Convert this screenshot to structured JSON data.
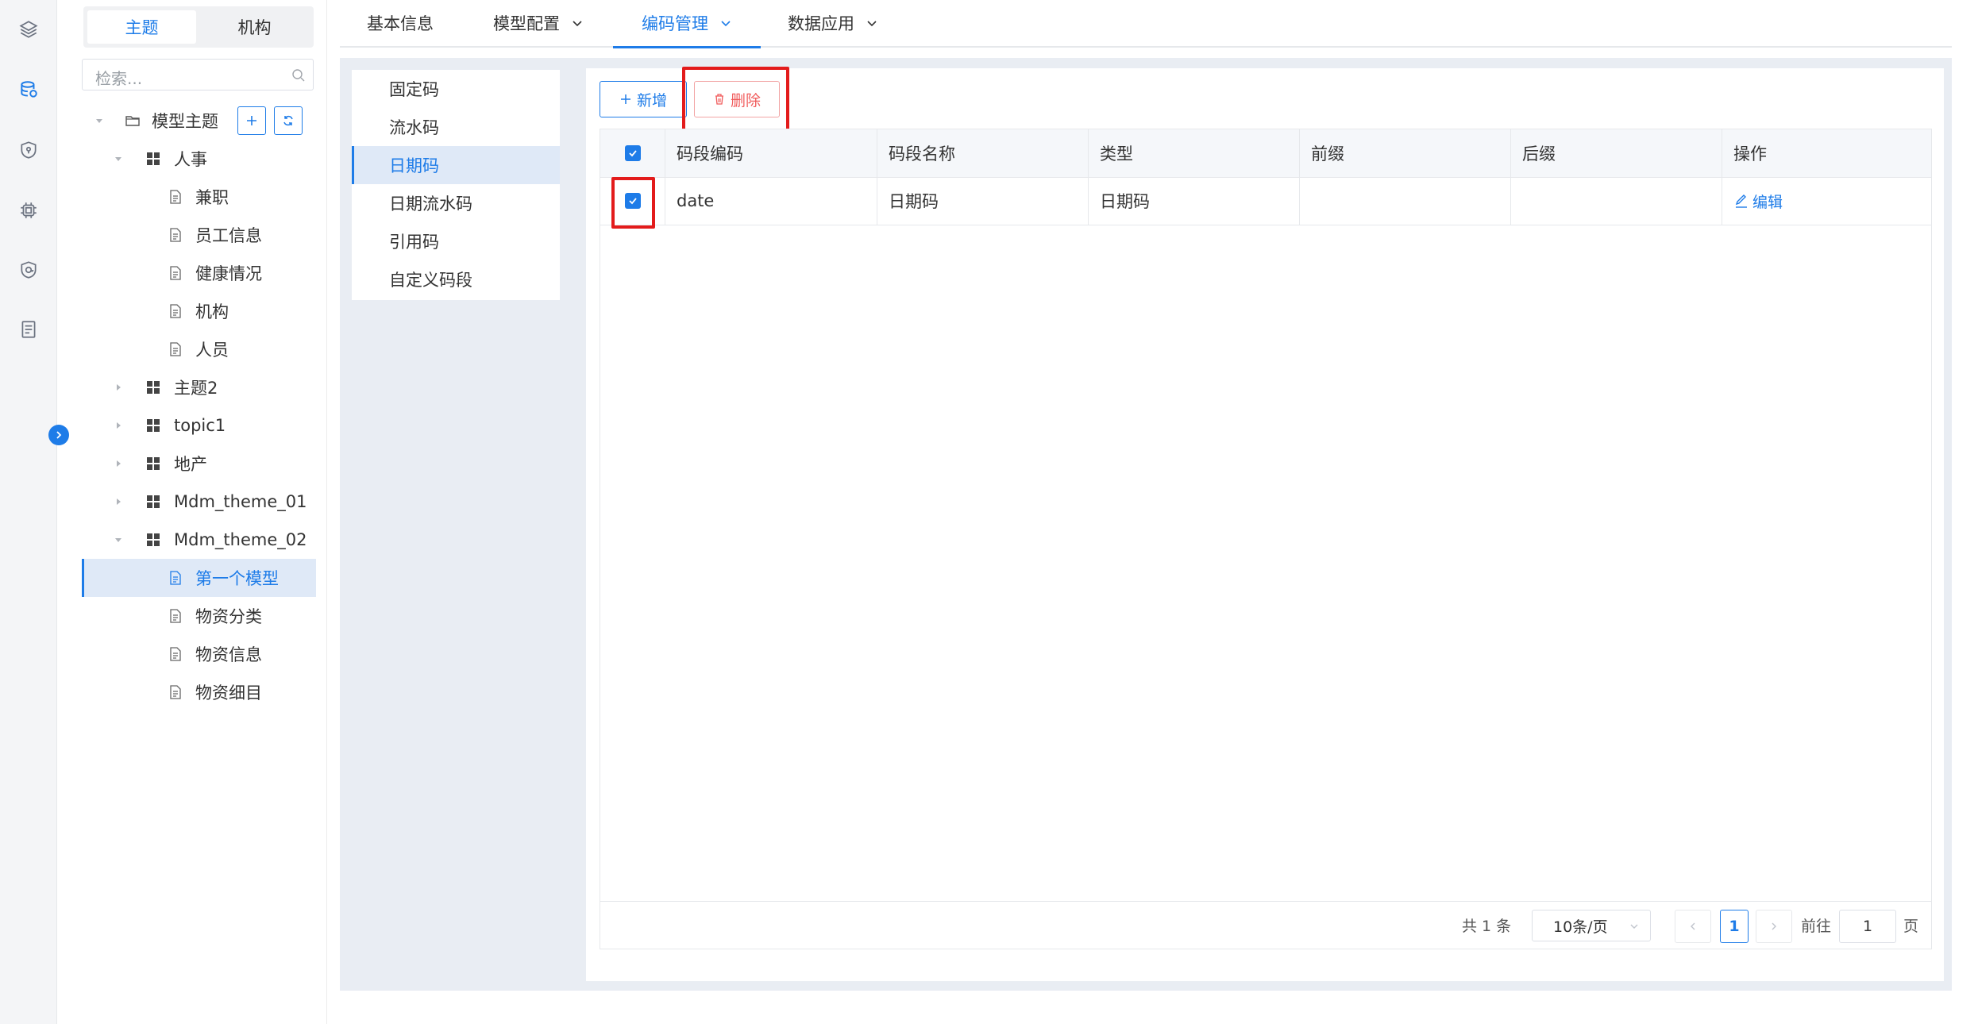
{
  "rail": {
    "icons": [
      "layers-icon",
      "database-icon",
      "shield-icon",
      "chip-icon",
      "security-icon",
      "document-list-icon"
    ]
  },
  "tree_panel": {
    "tabs": [
      "主题",
      "机构"
    ],
    "search_placeholder": "检索...",
    "root": "模型主题",
    "nodes": [
      {
        "label": "人事",
        "type": "group",
        "expanded": true
      },
      {
        "label": "兼职",
        "type": "leaf"
      },
      {
        "label": "员工信息",
        "type": "leaf"
      },
      {
        "label": "健康情况",
        "type": "leaf"
      },
      {
        "label": "机构",
        "type": "leaf"
      },
      {
        "label": "人员",
        "type": "leaf"
      },
      {
        "label": "主题2",
        "type": "group",
        "expanded": false
      },
      {
        "label": "topic1",
        "type": "group",
        "expanded": false
      },
      {
        "label": "地产",
        "type": "group",
        "expanded": false
      },
      {
        "label": "Mdm_theme_01",
        "type": "group",
        "expanded": false
      },
      {
        "label": "Mdm_theme_02",
        "type": "group",
        "expanded": true
      },
      {
        "label": "第一个模型",
        "type": "leaf",
        "selected": true
      },
      {
        "label": "物资分类",
        "type": "leaf"
      },
      {
        "label": "物资信息",
        "type": "leaf"
      },
      {
        "label": "物资细目",
        "type": "leaf"
      }
    ]
  },
  "top_tabs": [
    {
      "label": "基本信息",
      "dropdown": false,
      "active": false
    },
    {
      "label": "模型配置",
      "dropdown": true,
      "active": false
    },
    {
      "label": "编码管理",
      "dropdown": true,
      "active": true
    },
    {
      "label": "数据应用",
      "dropdown": true,
      "active": false
    }
  ],
  "code_types": [
    {
      "label": "固定码",
      "active": false
    },
    {
      "label": "流水码",
      "active": false
    },
    {
      "label": "日期码",
      "active": true
    },
    {
      "label": "日期流水码",
      "active": false
    },
    {
      "label": "引用码",
      "active": false
    },
    {
      "label": "自定义码段",
      "active": false
    }
  ],
  "toolbar": {
    "add_label": "新增",
    "delete_label": "删除"
  },
  "table": {
    "columns": [
      "码段编码",
      "码段名称",
      "类型",
      "前缀",
      "后缀",
      "操作"
    ],
    "rows": [
      {
        "checked": true,
        "code": "date",
        "name": "日期码",
        "type": "日期码",
        "prefix": "",
        "suffix": "",
        "action": "编辑"
      }
    ]
  },
  "pagination": {
    "total_text": "共 1 条",
    "page_size": "10条/页",
    "current_page": "1",
    "goto_label": "前往",
    "goto_value": "1",
    "page_unit": "页"
  },
  "colors": {
    "accent": "#1e7ce8",
    "danger": "#f05a5a",
    "highlight": "#e31b1b",
    "selected_bg": "#dfe9f7"
  }
}
